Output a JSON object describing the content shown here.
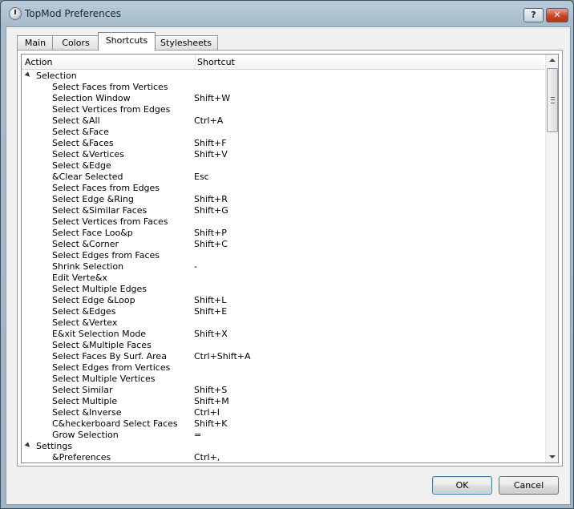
{
  "window": {
    "title": "TopMod Preferences",
    "help_label": "?",
    "close_label": "✕"
  },
  "tabs": [
    {
      "label": "Main"
    },
    {
      "label": "Colors"
    },
    {
      "label": "Shortcuts"
    },
    {
      "label": "Stylesheets"
    }
  ],
  "active_tab": "Shortcuts",
  "table": {
    "columns": [
      "Action",
      "Shortcut"
    ],
    "groups": [
      {
        "name": "Selection",
        "items": [
          {
            "action": "Select Faces from Vertices",
            "shortcut": ""
          },
          {
            "action": "Selection Window",
            "shortcut": "Shift+W"
          },
          {
            "action": "Select Vertices from Edges",
            "shortcut": ""
          },
          {
            "action": "Select &All",
            "shortcut": "Ctrl+A"
          },
          {
            "action": "Select &Face",
            "shortcut": ""
          },
          {
            "action": "Select &Faces",
            "shortcut": "Shift+F"
          },
          {
            "action": "Select &Vertices",
            "shortcut": "Shift+V"
          },
          {
            "action": "Select &Edge",
            "shortcut": ""
          },
          {
            "action": "&Clear Selected",
            "shortcut": "Esc"
          },
          {
            "action": "Select Faces from Edges",
            "shortcut": ""
          },
          {
            "action": "Select Edge &Ring",
            "shortcut": "Shift+R"
          },
          {
            "action": "Select &Similar Faces",
            "shortcut": "Shift+G"
          },
          {
            "action": "Select Vertices from Faces",
            "shortcut": ""
          },
          {
            "action": "Select Face Loo&p",
            "shortcut": "Shift+P"
          },
          {
            "action": "Select &Corner",
            "shortcut": "Shift+C"
          },
          {
            "action": "Select Edges from Faces",
            "shortcut": ""
          },
          {
            "action": "Shrink Selection",
            "shortcut": "-"
          },
          {
            "action": "Edit Verte&x",
            "shortcut": ""
          },
          {
            "action": "Select Multiple Edges",
            "shortcut": ""
          },
          {
            "action": "Select Edge &Loop",
            "shortcut": "Shift+L"
          },
          {
            "action": "Select &Edges",
            "shortcut": "Shift+E"
          },
          {
            "action": "Select &Vertex",
            "shortcut": ""
          },
          {
            "action": "E&xit Selection Mode",
            "shortcut": "Shift+X"
          },
          {
            "action": "Select &Multiple Faces",
            "shortcut": ""
          },
          {
            "action": "Select Faces By Surf. Area",
            "shortcut": "Ctrl+Shift+A"
          },
          {
            "action": "Select Edges from Vertices",
            "shortcut": ""
          },
          {
            "action": "Select Multiple Vertices",
            "shortcut": ""
          },
          {
            "action": "Select Similar",
            "shortcut": "Shift+S"
          },
          {
            "action": "Select Multiple",
            "shortcut": "Shift+M"
          },
          {
            "action": "Select &Inverse",
            "shortcut": "Ctrl+I"
          },
          {
            "action": "C&heckerboard Select Faces",
            "shortcut": "Shift+K"
          },
          {
            "action": "Grow Selection",
            "shortcut": "="
          }
        ]
      },
      {
        "name": "Settings",
        "items": [
          {
            "action": "&Preferences",
            "shortcut": "Ctrl+,"
          }
        ]
      }
    ]
  },
  "buttons": {
    "ok": "OK",
    "cancel": "Cancel"
  }
}
